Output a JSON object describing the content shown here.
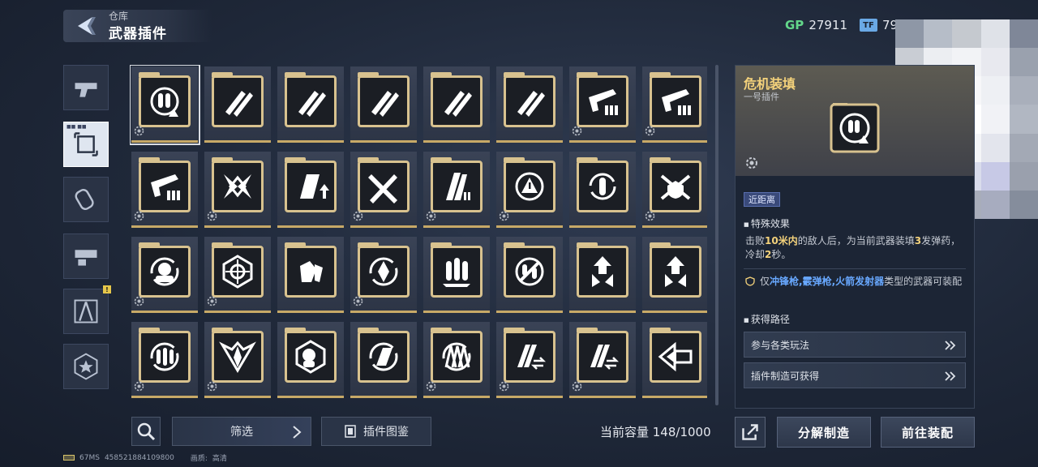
{
  "header": {
    "breadcrumb": "仓库",
    "title": "武器插件",
    "currency": [
      {
        "badge": "GP",
        "value": "27911"
      },
      {
        "badge": "TF",
        "value": "79"
      }
    ]
  },
  "categories": [
    {
      "icon": "pistol-icon",
      "active": false
    },
    {
      "icon": "plugin-chip-icon",
      "active": true,
      "label": "■■ ■■"
    },
    {
      "icon": "grenade-icon",
      "active": false
    },
    {
      "icon": "gun-module-icon",
      "active": false
    },
    {
      "icon": "compass-blueprint-icon",
      "active": false,
      "warning": "!"
    },
    {
      "icon": "star-badge-icon",
      "active": false
    }
  ],
  "plugins": [
    {
      "icon": "crisis-reload-icon",
      "gear": true,
      "selected": true
    },
    {
      "icon": "twin-bullets-icon",
      "gear": false
    },
    {
      "icon": "twin-bullets-icon",
      "gear": false
    },
    {
      "icon": "twin-bullets-icon",
      "gear": false
    },
    {
      "icon": "twin-bullets-icon",
      "gear": false
    },
    {
      "icon": "twin-bullets-icon",
      "gear": false
    },
    {
      "icon": "gun-ammo-icon",
      "gear": true
    },
    {
      "icon": "gun-ammo-icon",
      "gear": true
    },
    {
      "icon": "gun-ammo-icon",
      "gear": true
    },
    {
      "icon": "cross-blades-icon",
      "gear": true
    },
    {
      "icon": "magazine-up-icon",
      "gear": false
    },
    {
      "icon": "crossed-bullets-icon",
      "gear": true
    },
    {
      "icon": "magazine-stack-icon",
      "gear": true
    },
    {
      "icon": "warning-cycle-icon",
      "gear": true
    },
    {
      "icon": "bullet-cycle-icon",
      "gear": false
    },
    {
      "icon": "shield-swords-icon",
      "gear": true
    },
    {
      "icon": "headset-cycle-icon",
      "gear": true
    },
    {
      "icon": "crosshair-icon",
      "gear": true
    },
    {
      "icon": "gloves-icon",
      "gear": false
    },
    {
      "icon": "diamond-cycle-icon",
      "gear": true
    },
    {
      "icon": "triple-bullets-icon",
      "gear": false
    },
    {
      "icon": "no-ammo-icon",
      "gear": false
    },
    {
      "icon": "arrows-up-icon",
      "gear": false
    },
    {
      "icon": "arrows-up-icon",
      "gear": false
    },
    {
      "icon": "bullet-swap-icon",
      "gear": true
    },
    {
      "icon": "rocket-diamond-icon",
      "gear": true
    },
    {
      "icon": "head-shield-icon",
      "gear": false
    },
    {
      "icon": "magazine-reload-icon",
      "gear": false
    },
    {
      "icon": "triple-strike-icon",
      "gear": true
    },
    {
      "icon": "magazine-swap-icon",
      "gear": true
    },
    {
      "icon": "magazine-swap-icon",
      "gear": true
    },
    {
      "icon": "rush-arrows-icon",
      "gear": false
    }
  ],
  "bottom": {
    "filter_label": "筛选",
    "atlas_label": "插件图鉴",
    "capacity": "当前容量 148/1000",
    "dismantle_label": "分解制造",
    "equip_label": "前往装配"
  },
  "footer": {
    "ping": "67MS",
    "uid": "458521884109800",
    "quality_label": "画质:",
    "quality_value": "高清"
  },
  "detail": {
    "name": "危机装填",
    "subtitle": "一号插件",
    "tag": "近距离",
    "effect_title": "特殊效果",
    "effect_parts": [
      "击败",
      "10米内",
      "的敌人后，为当前武器装填",
      "3",
      "发弹药，冷却",
      "2",
      "秒。"
    ],
    "equip_parts": [
      "仅",
      "冲锋枪,霰弹枪,火箭发射器",
      "类型的武器可装配"
    ],
    "source_title": "获得路径",
    "sources": [
      "参与各类玩法",
      "插件制造可获得"
    ]
  },
  "colors": {
    "accent_gold": "#d8c28f",
    "name_gold": "#f4d27b",
    "weapon_blue": "#68a8ff",
    "gp_green": "#63d78a"
  }
}
